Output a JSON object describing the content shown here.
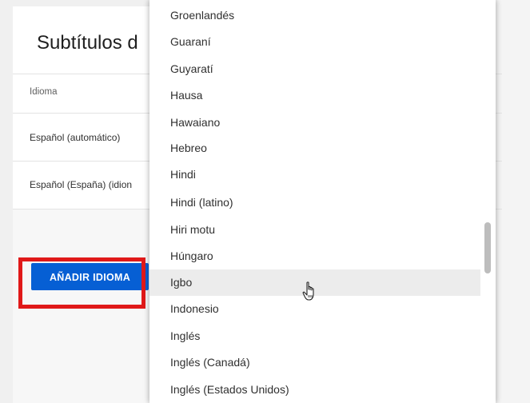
{
  "panel": {
    "title": "Subtítulos d",
    "column_header": "Idioma",
    "rows": [
      "Español (automático)",
      "Español (España) (idion"
    ],
    "add_button_label": "AÑADIR IDIOMA"
  },
  "dropdown": {
    "items": [
      "Groenlandés",
      "Guaraní",
      "Guyaratí",
      "Hausa",
      "Hawaiano",
      "Hebreo",
      "Hindi",
      "Hindi (latino)",
      "Hiri motu",
      "Húngaro",
      "Igbo",
      "Indonesio",
      "Inglés",
      "Inglés (Canadá)",
      "Inglés (Estados Unidos)"
    ],
    "hovered_item": "Igbo"
  },
  "colors": {
    "primary_button": "#065fd4",
    "highlight_box": "#e01919"
  },
  "icons": {
    "cursor": "hand-pointer-icon"
  }
}
